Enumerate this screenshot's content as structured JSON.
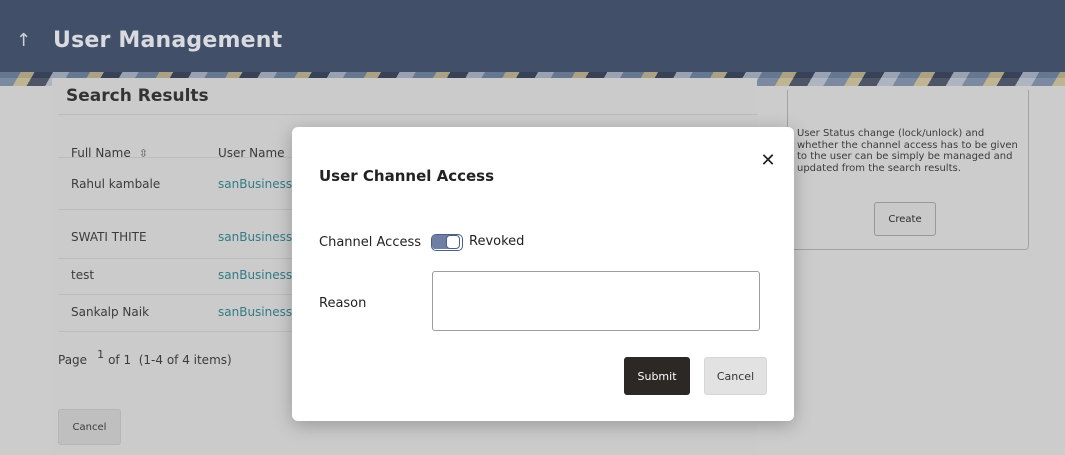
{
  "header": {
    "title": "User Management",
    "back_icon": "arrow-up-icon"
  },
  "search": {
    "title": "Search Results",
    "columns": [
      {
        "label": "Full Name",
        "sort_icon": "sort-toggle-icon"
      },
      {
        "label": "User Name"
      }
    ],
    "rows": [
      {
        "full_name": "Rahul kambale",
        "user_name": "sanBusiness"
      },
      {
        "full_name": "SWATI THITE",
        "user_name": "sanBusiness"
      },
      {
        "full_name": "test",
        "user_name": "sanBusiness"
      },
      {
        "full_name": "Sankalp Naik",
        "user_name": "sanBusiness"
      }
    ],
    "pager": {
      "page_label": "Page",
      "page": "1",
      "of": "of 1",
      "items": "(1-4 of 4 items)"
    },
    "cancel_label": "Cancel"
  },
  "side": {
    "text": "User Status change (lock/unlock) and whether the channel access has to be given to the user can be simply be managed and updated from the search results.",
    "create_label": "Create"
  },
  "modal": {
    "title": "User Channel Access",
    "close_icon": "close-icon",
    "channel_access_label": "Channel Access",
    "toggle_state": "Revoked",
    "reason_label": "Reason",
    "reason_value": "",
    "submit_label": "Submit",
    "cancel_label": "Cancel"
  },
  "colors": {
    "header": "#3a4a66",
    "primary_button": "#2c2826",
    "link": "#2a7a86",
    "toggle": "#6e7fa3"
  }
}
